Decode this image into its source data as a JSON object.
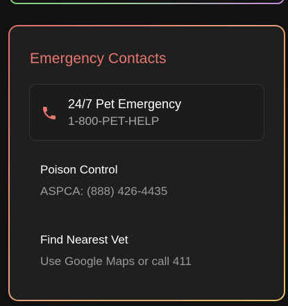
{
  "emergency_contacts": {
    "title": "Emergency Contacts",
    "accent_color": "#e8776f",
    "primary": {
      "icon": "phone-icon",
      "title": "24/7 Pet Emergency",
      "number": "1-800-PET-HELP"
    },
    "items": [
      {
        "title": "Poison Control",
        "detail": "ASPCA: (888) 426-4435"
      },
      {
        "title": "Find Nearest Vet",
        "detail": "Use Google Maps or call 411"
      }
    ]
  }
}
